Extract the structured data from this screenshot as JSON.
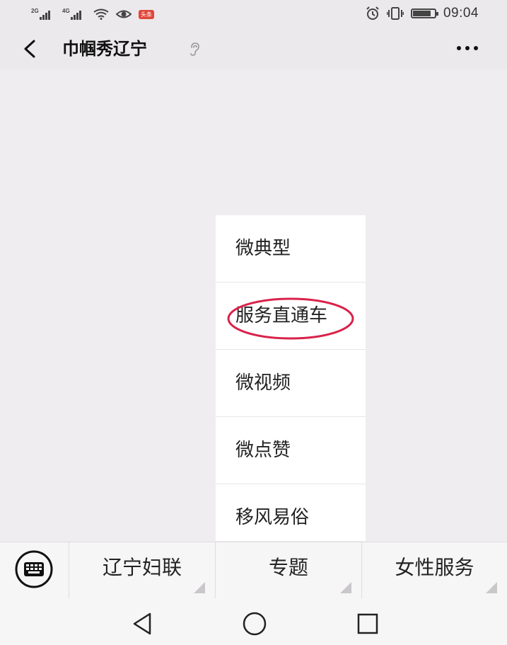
{
  "status_bar": {
    "sim1_network": "2G",
    "sim2_network": "4G",
    "notification_badge": "头条",
    "battery_level": 0.85,
    "time": "09:04"
  },
  "header": {
    "title": "巾帼秀辽宁",
    "title_icon": "hearing-ear-icon",
    "back_icon": "back-arrow-icon",
    "more_icon": "more-dots-icon"
  },
  "popup_menu": {
    "items": [
      {
        "label": "微典型"
      },
      {
        "label": "服务直通车",
        "highlighted": true
      },
      {
        "label": "微视频"
      },
      {
        "label": "微点赞"
      },
      {
        "label": "移风易俗"
      }
    ],
    "highlight_color": "#d9224a"
  },
  "bottom_menu": {
    "keyboard_icon": "keyboard-icon",
    "tabs": [
      {
        "label": "辽宁妇联"
      },
      {
        "label": "专题"
      },
      {
        "label": "女性服务"
      }
    ]
  },
  "nav_bar": {
    "icons": [
      "back-triangle-icon",
      "home-circle-icon",
      "recent-square-icon"
    ]
  }
}
